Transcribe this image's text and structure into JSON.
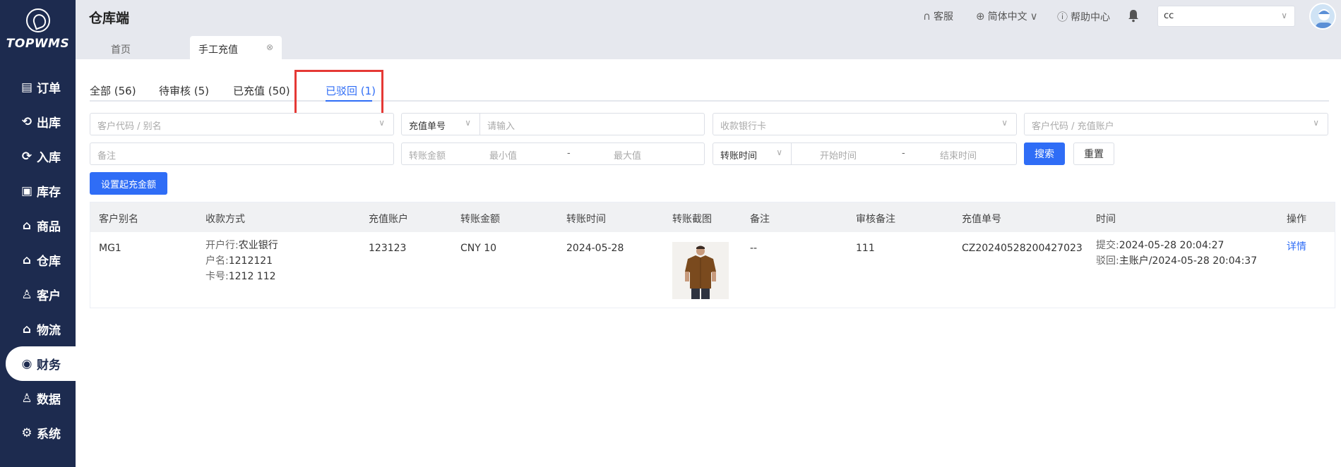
{
  "sidebar": {
    "logo": "TOPWMS",
    "items": [
      {
        "label": "订单",
        "icon": "order-icon",
        "glyph": "▤"
      },
      {
        "label": "出库",
        "icon": "outbound-icon",
        "glyph": "⟲"
      },
      {
        "label": "入库",
        "icon": "inbound-icon",
        "glyph": "⟳"
      },
      {
        "label": "库存",
        "icon": "inventory-icon",
        "glyph": "▣"
      },
      {
        "label": "商品",
        "icon": "product-icon",
        "glyph": "⌂"
      },
      {
        "label": "仓库",
        "icon": "warehouse-icon",
        "glyph": "⌂"
      },
      {
        "label": "客户",
        "icon": "customer-icon",
        "glyph": "♙"
      },
      {
        "label": "物流",
        "icon": "logistics-icon",
        "glyph": "⌂"
      },
      {
        "label": "财务",
        "icon": "finance-icon",
        "glyph": "◉"
      },
      {
        "label": "数据",
        "icon": "data-icon",
        "glyph": "♙"
      },
      {
        "label": "系统",
        "icon": "system-icon",
        "glyph": "⚙"
      }
    ],
    "active_index": 8
  },
  "header": {
    "title": "仓库端",
    "service": "客服",
    "language": "简体中文",
    "help": "帮助中心",
    "warehouse_value": "cc"
  },
  "page_tabs": [
    {
      "label": "首页"
    },
    {
      "label": "手工充值"
    }
  ],
  "status_tabs": [
    {
      "label": "全部 (56)"
    },
    {
      "label": "待审核 (5)"
    },
    {
      "label": "已充值 (50)"
    },
    {
      "label": "已驳回 (1)"
    }
  ],
  "filters": {
    "customer_placeholder": "客户代码 / 别名",
    "order_type": "充值单号",
    "order_placeholder": "请输入",
    "bank_placeholder": "收款银行卡",
    "account_placeholder": "客户代码 / 充值账户",
    "remark_placeholder": "备注",
    "amount_label": "转账金额",
    "min_placeholder": "最小值",
    "range_sep": "-",
    "max_placeholder": "最大值",
    "time_type": "转账时间",
    "start_placeholder": "开始时间",
    "end_placeholder": "结束时间",
    "search": "搜索",
    "reset": "重置",
    "set_min_amount": "设置起充金额"
  },
  "table": {
    "headers": [
      "客户别名",
      "收款方式",
      "充值账户",
      "转账金额",
      "转账时间",
      "转账截图",
      "备注",
      "审核备注",
      "充值单号",
      "时间",
      "操作"
    ],
    "rows": [
      {
        "alias": "MG1",
        "bank_label": "开户行:",
        "bank": "农业银行",
        "name_label": "户名:",
        "name": "1212121",
        "card_label": "卡号:",
        "card": "1212 112",
        "account": "123123",
        "amount": "CNY 10",
        "transfer_time": "2024-05-28",
        "remark": "--",
        "audit_remark": "111",
        "order_no": "CZ20240528200427023",
        "submit_label": "提交:",
        "submit_time": "2024-05-28 20:04:27",
        "reject_label": "驳回:",
        "reject_info": "主账户/2024-05-28 20:04:37",
        "action": "详情"
      }
    ]
  }
}
